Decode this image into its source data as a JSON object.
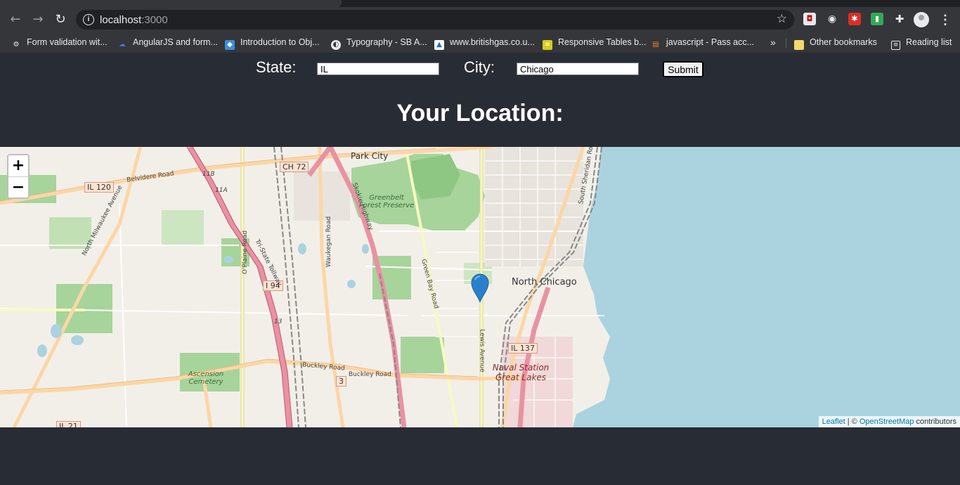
{
  "browser": {
    "url_host": "localhost",
    "url_port": ":3000",
    "bookmarks": [
      {
        "label": "Form validation wit...",
        "icon": "gear-icon",
        "color": "#e8eaed"
      },
      {
        "label": "AngularJS and form...",
        "icon": "cloud-icon",
        "color": "#4a6fd4"
      },
      {
        "label": "Introduction to Obj...",
        "icon": "site-icon",
        "color": "#3a8fd8"
      },
      {
        "label": "Typography - SB A...",
        "icon": "globe-icon",
        "color": "#e8eaed"
      },
      {
        "label": "www.britishgas.co.u...",
        "icon": "britishgas-icon",
        "color": "#0a73c2"
      },
      {
        "label": "Responsive Tables b...",
        "icon": "tables-icon",
        "color": "#d4cc1a"
      },
      {
        "label": "javascript - Pass acc...",
        "icon": "stackoverflow-icon",
        "color": "#f48024"
      }
    ],
    "more_bookmarks": "»",
    "other_bookmarks": "Other bookmarks",
    "reading_list": "Reading list"
  },
  "form": {
    "state_label": "State:",
    "state_value": "IL",
    "city_label": "City:",
    "city_value": "Chicago",
    "submit_label": "Submit"
  },
  "heading": "Your Location:",
  "map": {
    "zoom_in": "+",
    "zoom_out": "−",
    "labels": {
      "park_city": "Park City",
      "north_chicago": "North Chicago",
      "greenbelt": "Greenbelt Forest Preserve",
      "ascension": "Ascension Cemetery",
      "naval_station": "Naval Station Great Lakes"
    },
    "shields": [
      "IL 120",
      "CH 72",
      "I 94",
      "IL 137",
      "IL 21",
      "3"
    ],
    "roads": [
      "Belvidere Road",
      "Buckley Road",
      "Buckley Road",
      "Green Bay Road",
      "Lewis Avenue",
      "Skokie Highway",
      "Tri-State Tollway",
      "O'Plaine Road",
      "Waukegan Road",
      "North Milwaukee Avenue",
      "South Sheridan Road",
      "11B",
      "11A",
      "13"
    ],
    "attribution": {
      "leaflet": "Leaflet",
      "separator": " | © ",
      "osm": "OpenStreetMap",
      "suffix": " contributors"
    },
    "colors": {
      "water": "#aad3df",
      "land": "#f2efe9",
      "park": "#a7d49b",
      "forest": "#8ec784",
      "highway": "#e892a2",
      "primary": "#fcd6a4",
      "marker": "#2a81cb"
    }
  }
}
